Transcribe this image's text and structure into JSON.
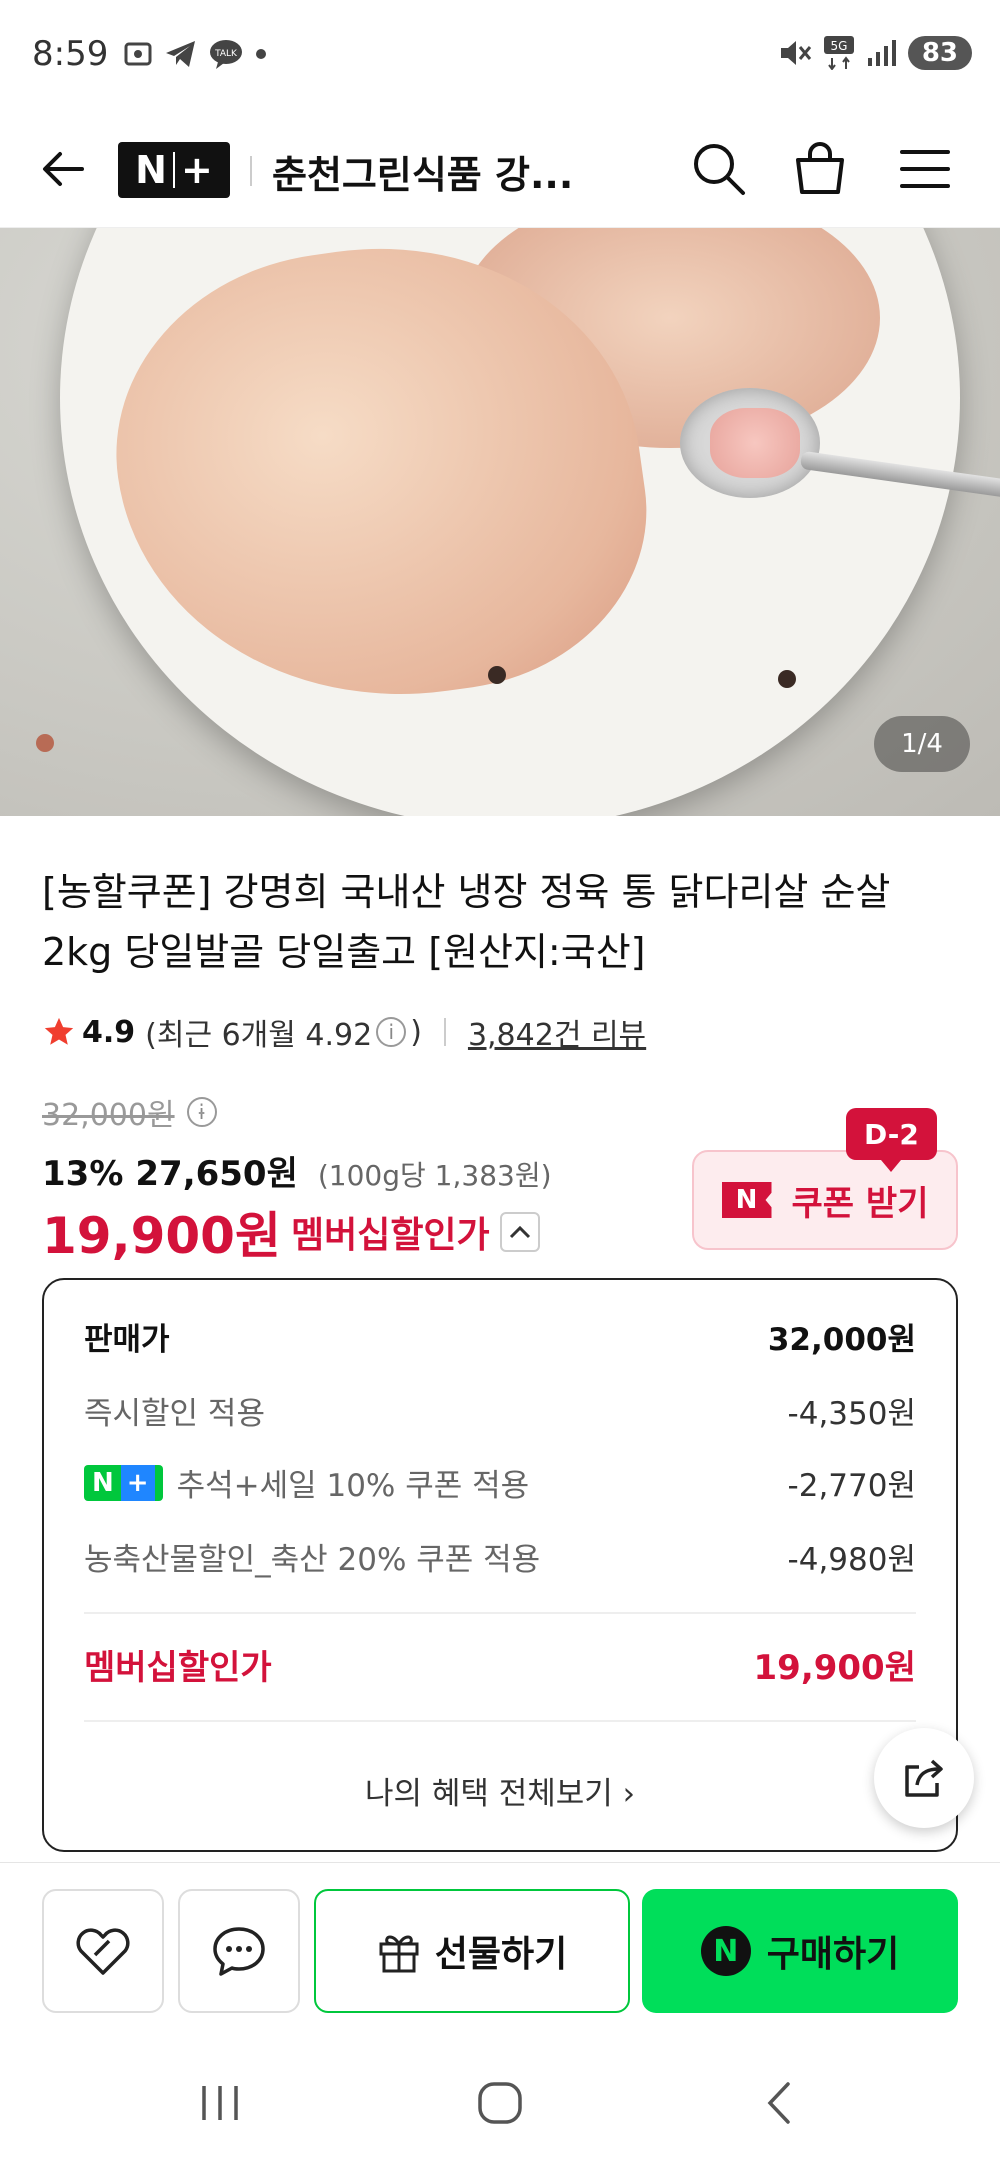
{
  "status_bar": {
    "time": "8:59",
    "network": "5G",
    "battery": "83"
  },
  "header": {
    "logo": "N+",
    "title": "춘천그린식품 강..."
  },
  "gallery": {
    "counter": "1/4"
  },
  "product": {
    "title": "[농할쿠폰] 강명희 국내산 냉장 정육 통 닭다리살 순살 2kg 당일발골 당일출고 [원산지:국산]",
    "rating": "4.9",
    "rating_detail": "(최근 6개월 4.92",
    "rating_detail_end": ")",
    "reviews": "3,842건 리뷰",
    "original_price": "32,000원",
    "discount_pct": "13%",
    "sale_price": "27,650원",
    "unit_price": "(100g당 1,383원)",
    "member_price": "19,900원",
    "member_label": "멤버십할인가"
  },
  "coupon": {
    "badge": "D-2",
    "n_badge": "N",
    "label": "쿠폰 받기"
  },
  "breakdown": {
    "rows": [
      {
        "label": "판매가",
        "value": "32,000원"
      },
      {
        "label": "즉시할인 적용",
        "value": "-4,350원"
      },
      {
        "label": "추석+세일 10% 쿠폰 적용",
        "value": "-2,770원",
        "badge": "N+"
      },
      {
        "label": "농축산물할인_축산 20% 쿠폰 적용",
        "value": "-4,980원"
      }
    ],
    "total_label": "멤버십할인가",
    "total_value": "19,900원",
    "more_label": "나의 혜택 전체보기 ›"
  },
  "actions": {
    "gift_label": "선물하기",
    "buy_label": "구매하기",
    "buy_badge": "N"
  },
  "colors": {
    "accent_red": "#d3123b",
    "naver_green": "#00de5a",
    "plus_blue": "#1f86ff"
  }
}
